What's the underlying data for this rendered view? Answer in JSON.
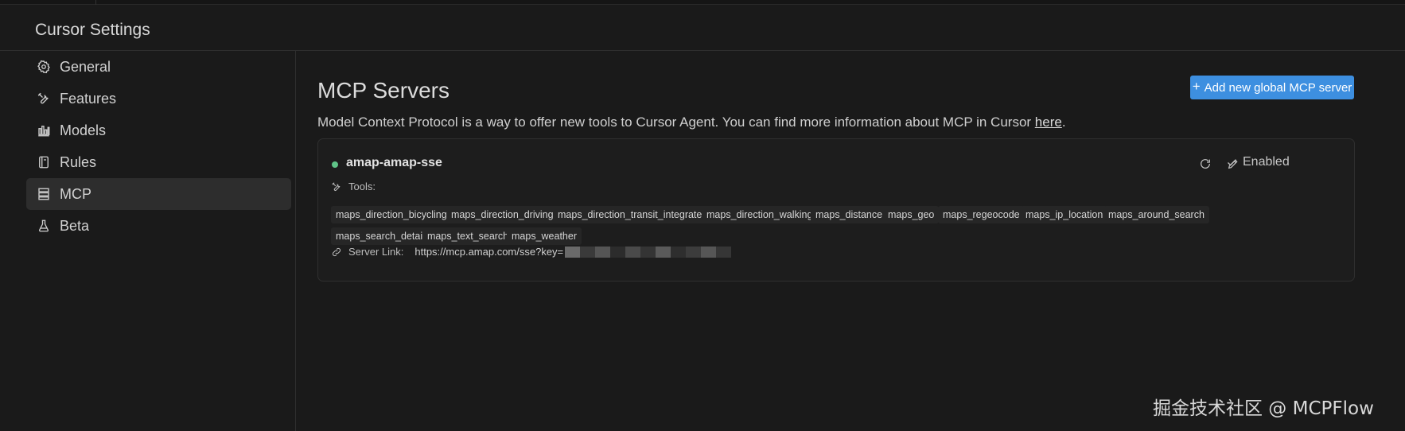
{
  "window": {
    "title": "Cursor Settings"
  },
  "sidebar": {
    "items": [
      {
        "label": "General",
        "icon": "gear-icon"
      },
      {
        "label": "Features",
        "icon": "tools-icon"
      },
      {
        "label": "Models",
        "icon": "bar-chart-icon"
      },
      {
        "label": "Rules",
        "icon": "book-icon"
      },
      {
        "label": "MCP",
        "icon": "server-stack-icon",
        "active": true
      },
      {
        "label": "Beta",
        "icon": "flask-icon"
      }
    ]
  },
  "main": {
    "title": "MCP Servers",
    "add_button": {
      "icon": "plus-icon",
      "label": "Add new global MCP server"
    },
    "description": {
      "text": "Model Context Protocol is a way to offer new tools to Cursor Agent. You can find more information about MCP in Cursor ",
      "link": "here",
      "suffix": "."
    },
    "server": {
      "name": "amap-amap-sse",
      "status_color": "#5fc488",
      "enabled_label": "Enabled",
      "tools_label": "Tools:",
      "tools": [
        "maps_direction_bicycling",
        "maps_direction_driving",
        "maps_direction_transit_integrated",
        "maps_direction_walking",
        "maps_distance",
        "maps_geo",
        "maps_regeocode",
        "maps_ip_location",
        "maps_around_search",
        "maps_search_detail",
        "maps_text_search",
        "maps_weather"
      ],
      "link_label": "Server Link:",
      "link_url": "https://mcp.amap.com/sse?key="
    }
  },
  "watermark": "掘金技术社区 @ MCPFlow",
  "colors": {
    "accent": "#3d8fe0",
    "background": "#1a1a1a"
  }
}
